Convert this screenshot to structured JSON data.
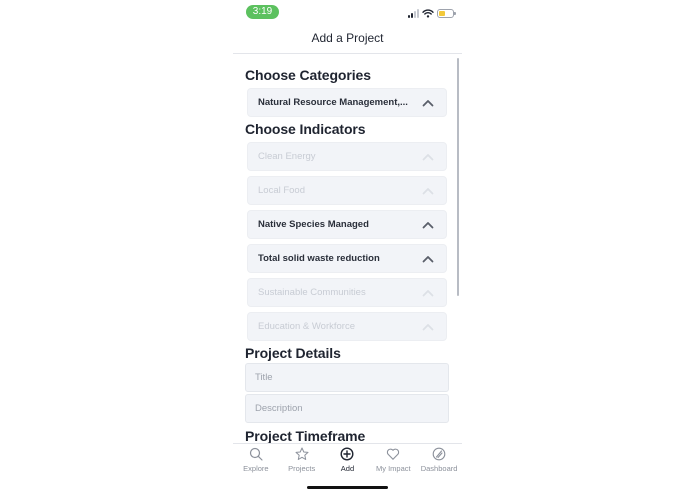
{
  "status_bar": {
    "time": "3:19",
    "icons": [
      "signal-icon",
      "wifi-icon",
      "battery-icon"
    ],
    "time_color": "#5cc15f",
    "battery_color": "#f3c93a"
  },
  "nav": {
    "title": "Add a Project"
  },
  "categories": {
    "title": "Choose Categories",
    "selected": "Natural Resource Management,..."
  },
  "indicators": {
    "title": "Choose Indicators",
    "items": [
      {
        "label": "Clean Energy",
        "enabled": false
      },
      {
        "label": "Local Food",
        "enabled": false
      },
      {
        "label": "Native Species Managed",
        "enabled": true
      },
      {
        "label": "Total solid waste reduction",
        "enabled": true
      },
      {
        "label": "Sustainable Communities",
        "enabled": false
      },
      {
        "label": "Education & Workforce",
        "enabled": false
      }
    ]
  },
  "details": {
    "title": "Project Details",
    "title_placeholder": "Title",
    "description_placeholder": "Description"
  },
  "timeframe": {
    "title": "Project Timeframe"
  },
  "tabs": [
    {
      "label": "Explore",
      "icon": "search-icon",
      "active": false
    },
    {
      "label": "Projects",
      "icon": "star-icon",
      "active": false
    },
    {
      "label": "Add",
      "icon": "plus-circle-icon",
      "active": true
    },
    {
      "label": "My Impact",
      "icon": "heart-icon",
      "active": false
    },
    {
      "label": "Dashboard",
      "icon": "dashboard-icon",
      "active": false
    }
  ]
}
